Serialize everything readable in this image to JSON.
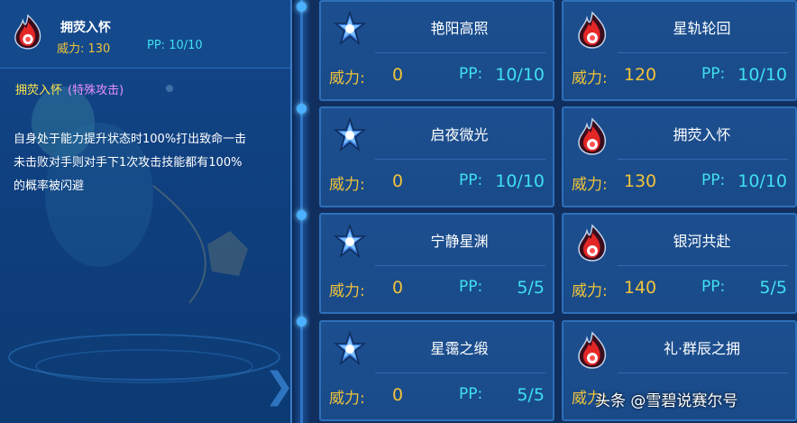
{
  "detail": {
    "name": "拥荧入怀",
    "power_text": "威力: 130",
    "pp_text": "PP: 10/10",
    "subtitle_name": "拥荧入怀",
    "subtitle_type": "(特殊攻击)",
    "description_lines": [
      "自身处于能力提升状态时100%打出致命一击",
      "未击败对手则对手下1次攻击技能都有100%",
      "的概率被闪避"
    ]
  },
  "labels": {
    "power": "威力:",
    "pp": "PP:"
  },
  "skills": [
    {
      "name": "艳阳高照",
      "icon": "star-icon",
      "power": "0",
      "pp": "10/10"
    },
    {
      "name": "星轨轮回",
      "icon": "fire-icon",
      "power": "120",
      "pp": "10/10"
    },
    {
      "name": "启夜微光",
      "icon": "star-icon",
      "power": "0",
      "pp": "10/10"
    },
    {
      "name": "拥荧入怀",
      "icon": "fire-icon",
      "power": "130",
      "pp": "10/10"
    },
    {
      "name": "宁静星渊",
      "icon": "star-icon",
      "power": "0",
      "pp": "5/5"
    },
    {
      "name": "银河共赴",
      "icon": "fire-icon",
      "power": "140",
      "pp": "5/5"
    },
    {
      "name": "星霭之缎",
      "icon": "star-icon",
      "power": "0",
      "pp": "5/5"
    },
    {
      "name": "礼·群辰之拥",
      "icon": "fire-icon",
      "power": "",
      "pp": ""
    }
  ],
  "watermark": "头条 @雪碧说赛尔号",
  "colors": {
    "power": "#f0c33a",
    "pp": "#3fe0f0",
    "card_bg": "#1c4f90",
    "card_border": "#2e6fb9"
  }
}
